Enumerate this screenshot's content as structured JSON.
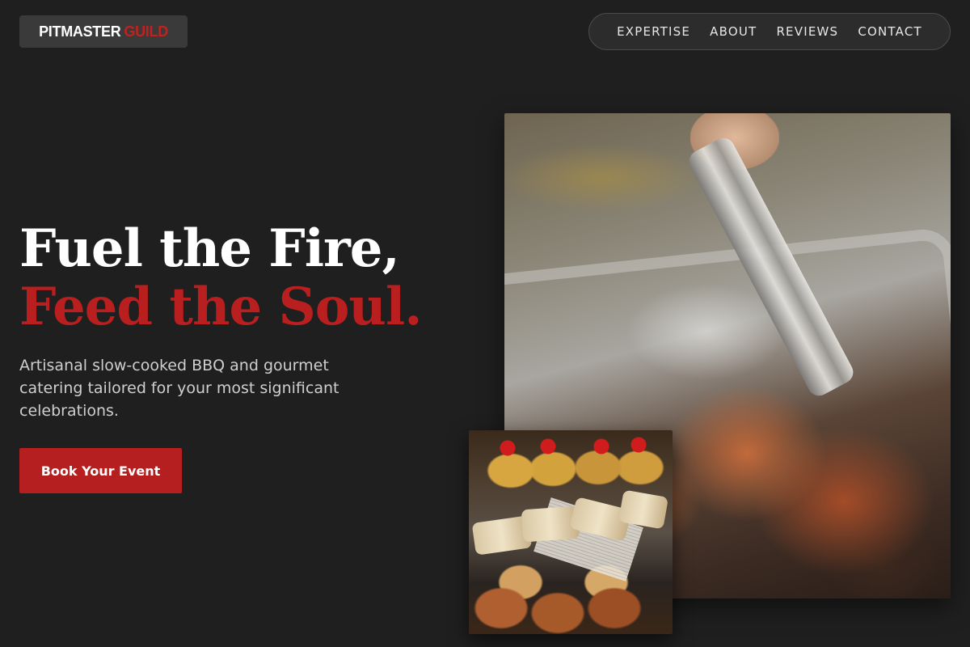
{
  "brand": {
    "part1": "PITMASTER",
    "part2": "GUILD"
  },
  "nav": {
    "items": [
      {
        "label": "EXPERTISE"
      },
      {
        "label": "ABOUT"
      },
      {
        "label": "REVIEWS"
      },
      {
        "label": "CONTACT"
      }
    ]
  },
  "hero": {
    "title_line1": "Fuel the Fire,",
    "title_line2": "Feed the Soul.",
    "subtitle": "Artisanal slow-cooked BBQ and gourmet catering tailored for your most significant celebrations.",
    "cta_label": "Book Your Event"
  },
  "colors": {
    "background": "#1f1f1f",
    "accent": "#b91f1f",
    "text": "#ffffff",
    "muted_text": "#cfcfcf"
  }
}
